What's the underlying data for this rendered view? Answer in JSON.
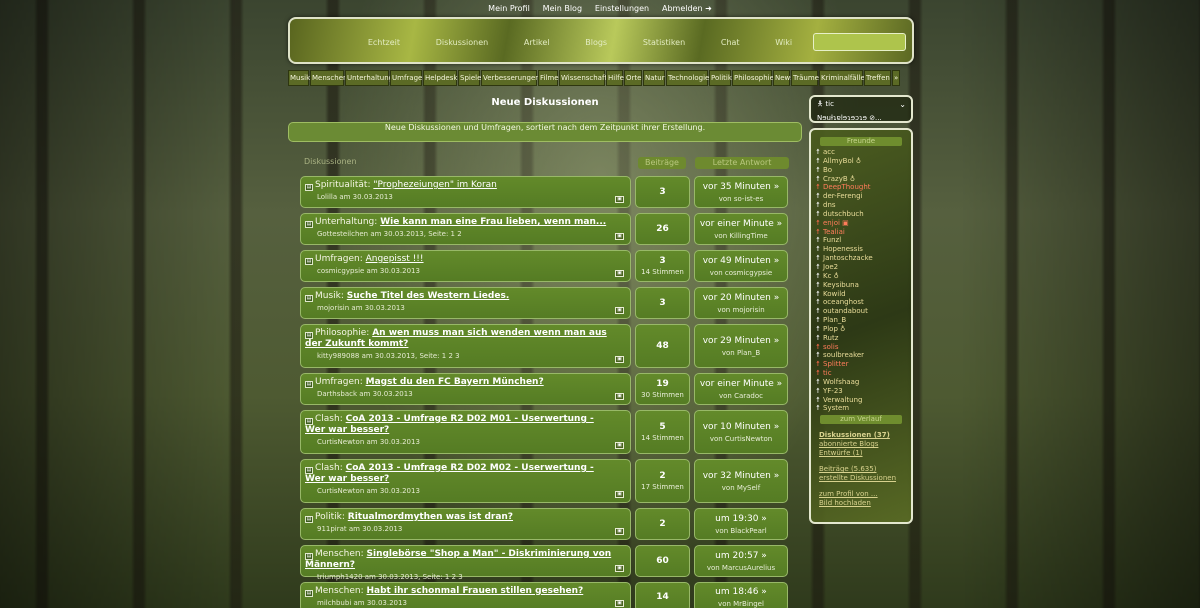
{
  "topnav": [
    "Mein Profil",
    "Mein Blog",
    "Einstellungen",
    "Abmelden ➜"
  ],
  "header": {
    "nav": [
      "Echtzeit",
      "Diskussionen",
      "Artikel",
      "Blogs",
      "Statistiken",
      "Chat",
      "Wiki"
    ],
    "search_placeholder": ""
  },
  "categories": [
    "Musik",
    "Menschen",
    "Unterhaltung",
    "Umfragen",
    "Helpdesk",
    "Spiele",
    "Verbesserungen",
    "Filme",
    "Wissenschaft",
    "Hilfe",
    "Orte",
    "Natur",
    "Technologie",
    "Politik",
    "Philosophie",
    "News",
    "Träume",
    "Kriminalfälle",
    "Treffen",
    "»"
  ],
  "main": {
    "title": "Neue Diskussionen",
    "intro": "Neue Diskussionen und Umfragen, sortiert nach dem Zeitpunkt ihrer Erstellung.",
    "col_discussions": "Diskussionen",
    "col_posts": "Beiträge",
    "col_last": "Letzte Antwort"
  },
  "discussions": [
    {
      "category": "Spiritualität:",
      "title": "\"Prophezeiungen\" im Koran",
      "bold": false,
      "meta": "Lolilla am 30.03.2013",
      "count": "3",
      "votes": "",
      "last_time": "vor 35 Minuten »",
      "last_user": "von so-ist-es"
    },
    {
      "category": "Unterhaltung:",
      "title": "Wie kann man eine Frau lieben, wenn man...",
      "bold": true,
      "meta": "Gottesteilchen am 30.03.2013, Seite: 1 2",
      "count": "26",
      "votes": "",
      "last_time": "vor einer Minute »",
      "last_user": "von KillingTime"
    },
    {
      "category": "Umfragen:",
      "title": "Angepisst !!!",
      "bold": false,
      "meta": "cosmicgypsie am 30.03.2013",
      "count": "3",
      "votes": "14 Stimmen",
      "last_time": "vor 49 Minuten »",
      "last_user": "von cosmicgypsie"
    },
    {
      "category": "Musik:",
      "title": "Suche Titel des Western Liedes.",
      "bold": true,
      "meta": "mojorisin am 30.03.2013",
      "count": "3",
      "votes": "",
      "last_time": "vor 20 Minuten »",
      "last_user": "von mojorisin"
    },
    {
      "category": "Philosophie:",
      "title": "An wen muss man sich wenden wenn man aus der Zukunft kommt?",
      "bold": true,
      "meta": "kitty989088 am 30.03.2013, Seite: 1 2 3",
      "count": "48",
      "votes": "",
      "last_time": "vor 29 Minuten »",
      "last_user": "von Plan_B"
    },
    {
      "category": "Umfragen:",
      "title": "Magst du den FC Bayern München?",
      "bold": true,
      "meta": "Darthsback am 30.03.2013",
      "count": "19",
      "votes": "30 Stimmen",
      "last_time": "vor einer Minute »",
      "last_user": "von Caradoc"
    },
    {
      "category": "Clash:",
      "title": "CoA 2013 - Umfrage R2 D02 M01 - Userwertung - Wer war besser?",
      "bold": true,
      "meta": "CurtisNewton am 30.03.2013",
      "count": "5",
      "votes": "14 Stimmen",
      "last_time": "vor 10 Minuten »",
      "last_user": "von CurtisNewton"
    },
    {
      "category": "Clash:",
      "title": "CoA 2013 - Umfrage R2 D02 M02 - Userwertung - Wer war besser?",
      "bold": true,
      "meta": "CurtisNewton am 30.03.2013",
      "count": "2",
      "votes": "17 Stimmen",
      "last_time": "vor 32 Minuten »",
      "last_user": "von MySelf"
    },
    {
      "category": "Politik:",
      "title": "Ritualmordmythen was ist dran?",
      "bold": true,
      "meta": "911pirat am 30.03.2013",
      "count": "2",
      "votes": "",
      "last_time": "um 19:30 »",
      "last_user": "von BlackPearl"
    },
    {
      "category": "Menschen:",
      "title": "Singlebörse \"Shop a Man\" - Diskriminierung von Männern?",
      "bold": true,
      "meta": "triumph1420 am 30.03.2013, Seite: 1 2 3",
      "count": "60",
      "votes": "",
      "last_time": "um 20:57 »",
      "last_user": "von MarcusAurelius"
    },
    {
      "category": "Menschen:",
      "title": "Habt ihr schonmal Frauen stillen gesehen?",
      "bold": true,
      "meta": "milchbubi am 30.03.2013",
      "count": "14",
      "votes": "",
      "last_time": "um 18:46 »",
      "last_user": "von MrBingel"
    }
  ],
  "user": {
    "name": "tic",
    "status": "Nɘuƚɿɐlɘɿɘɔɿɘ ⊘..."
  },
  "side": {
    "friends_title": "Freunde",
    "friends": [
      {
        "name": "acc",
        "red": false
      },
      {
        "name": "AllmyBol ♁",
        "red": false
      },
      {
        "name": "Bo",
        "red": false
      },
      {
        "name": "CrazyB ♁",
        "red": false
      },
      {
        "name": "DeepThought",
        "red": true
      },
      {
        "name": "der-Ferengi",
        "red": false
      },
      {
        "name": "dns",
        "red": false
      },
      {
        "name": "dutschbuch",
        "red": false
      },
      {
        "name": "enjoi ▣",
        "red": true
      },
      {
        "name": "Tealiai",
        "red": true
      },
      {
        "name": "Funzl",
        "red": false
      },
      {
        "name": "Hopenessis",
        "red": false
      },
      {
        "name": "Jantoschzacke",
        "red": false
      },
      {
        "name": "Joe2",
        "red": false
      },
      {
        "name": "Kc ♁",
        "red": false
      },
      {
        "name": "Keysibuna",
        "red": false
      },
      {
        "name": "Kowild",
        "red": false
      },
      {
        "name": "oceanghost",
        "red": false
      },
      {
        "name": "outandabout",
        "red": false
      },
      {
        "name": "Plan_B",
        "red": false
      },
      {
        "name": "Plop ♁",
        "red": false
      },
      {
        "name": "Rutz",
        "red": false
      },
      {
        "name": "solis",
        "red": true
      },
      {
        "name": "soulbreaker",
        "red": false
      },
      {
        "name": "Splitter",
        "red": true
      },
      {
        "name": "tic",
        "red": true
      },
      {
        "name": "Wolfshaag",
        "red": false
      },
      {
        "name": "YF-23",
        "red": false
      },
      {
        "name": "Verwaltung",
        "red": false
      },
      {
        "name": "System",
        "red": false
      }
    ],
    "history_title": "zum Verlauf",
    "links": [
      {
        "label": "Diskussionen (37)",
        "strong": true
      },
      {
        "label": "abonnierte Blogs",
        "strong": false
      },
      {
        "label": "Entwürfe (1)",
        "strong": false
      },
      {
        "label": "",
        "gap": true
      },
      {
        "label": "Beiträge (5.635)",
        "strong": false
      },
      {
        "label": "erstellte Diskussionen",
        "strong": false
      },
      {
        "label": "",
        "gap": true
      },
      {
        "label": "zum Profil von ...",
        "strong": false
      },
      {
        "label": "Bild hochladen",
        "strong": false
      }
    ]
  }
}
